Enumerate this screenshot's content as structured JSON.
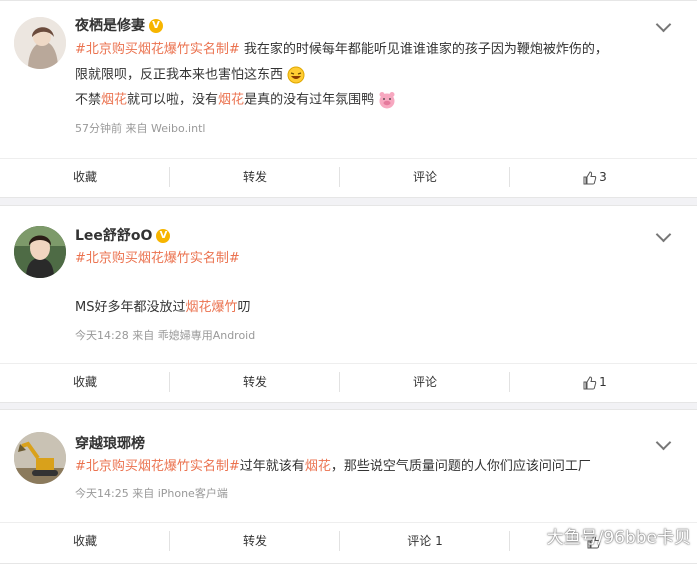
{
  "posts": [
    {
      "username": "夜栖是修妻",
      "verified_badge": "V",
      "hashtag": "#北京购买烟花爆竹实名制#",
      "line1_text": " 我在家的时候每年都能听见谁谁谁家的孩子因为鞭炮被炸伤的，",
      "line2_text": "限就限呗，反正我本来也害怕这东西",
      "line3_pre": "不禁",
      "line3_kw1": "烟花",
      "line3_mid": "就可以啦，没有",
      "line3_kw2": "烟花",
      "line3_post": "是真的没有过年氛围鸭",
      "meta": "57分钟前 来自 Weibo.intl",
      "actions": {
        "favorite": "收藏",
        "repost": "转发",
        "comment": "评论",
        "like": "3"
      }
    },
    {
      "username": "Lee舒舒oO",
      "verified_badge": "V",
      "hashtag": "#北京购买烟花爆竹实名制#",
      "body_pre": "MS好多年都没放过",
      "body_kw": "烟花爆竹",
      "body_post": "叨",
      "meta": "今天14:28 来自 乖媳婦専用Android",
      "actions": {
        "favorite": "收藏",
        "repost": "转发",
        "comment": "评论",
        "like": "1"
      }
    },
    {
      "username": "穿越琅琊榜",
      "hashtag": "#北京购买烟花爆竹实名制#",
      "body_mid": "过年就该有",
      "body_kw": "烟花",
      "body_post": "，那些说空气质量问题的人你们应该问问工厂",
      "meta": "今天14:25 来自 iPhone客户端",
      "actions": {
        "favorite": "收藏",
        "repost": "转发",
        "comment": "评论 1"
      }
    }
  ],
  "watermark": "大鱼号/96bbe卡贝",
  "colors": {
    "hashtag": "#eb7350",
    "verified": "#f7b500",
    "meta": "#999999"
  }
}
